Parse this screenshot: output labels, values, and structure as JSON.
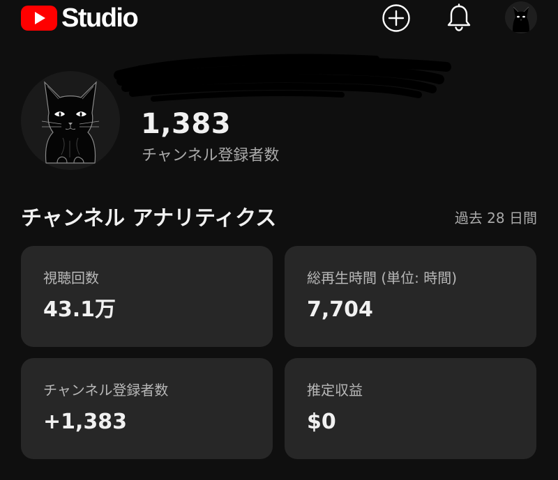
{
  "app": {
    "logo_text": "Studio"
  },
  "icons": {
    "create": "plus-circle-icon",
    "notifications": "bell-icon",
    "account": "cat-avatar-icon"
  },
  "channel": {
    "subscriber_count": "1,383",
    "subscriber_label": "チャンネル登録者数"
  },
  "analytics": {
    "title": "チャンネル アナリティクス",
    "period": "過去 28 日間",
    "metrics": [
      {
        "label": "視聴回数",
        "value": "43.1万"
      },
      {
        "label": "総再生時間 (単位: 時間)",
        "value": "7,704"
      },
      {
        "label": "チャンネル登録者数",
        "value": "+1,383"
      },
      {
        "label": "推定収益",
        "value": "$0"
      }
    ]
  },
  "colors": {
    "background": "#0f0f0f",
    "card": "#272727",
    "brand_red": "#ff0000",
    "text_primary": "#f1f1f1",
    "text_secondary": "#aaaaaa"
  }
}
